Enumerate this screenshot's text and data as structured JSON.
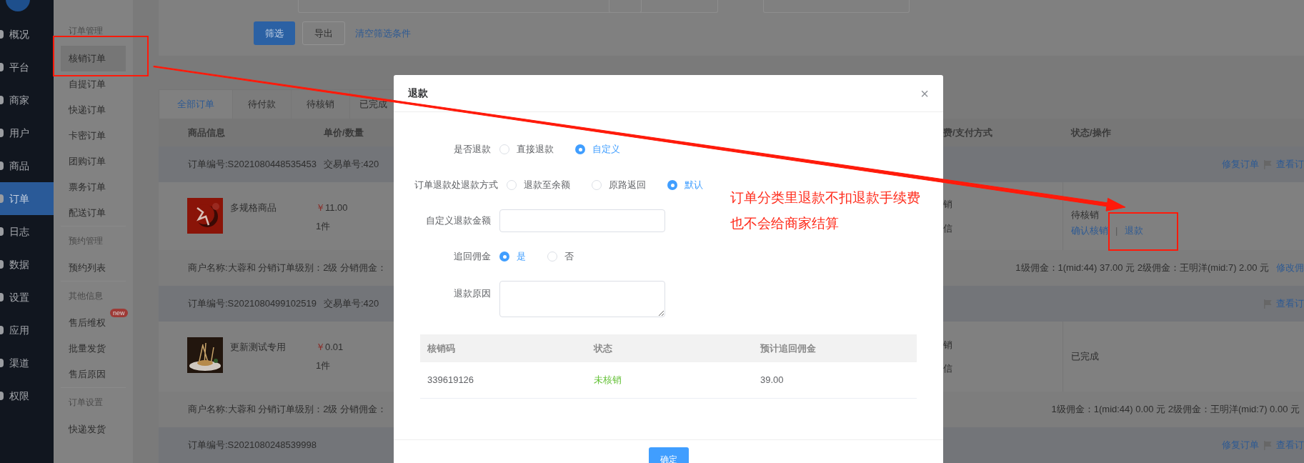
{
  "main_nav": {
    "items": [
      {
        "label": "概况",
        "selected": false
      },
      {
        "label": "平台",
        "selected": false
      },
      {
        "label": "商家",
        "selected": false
      },
      {
        "label": "用户",
        "selected": false
      },
      {
        "label": "商品",
        "selected": false
      },
      {
        "label": "订单",
        "selected": true
      },
      {
        "label": "日志",
        "selected": false
      },
      {
        "label": "数据",
        "selected": false
      },
      {
        "label": "设置",
        "selected": false
      },
      {
        "label": "应用",
        "selected": false
      },
      {
        "label": "渠道",
        "selected": false
      },
      {
        "label": "权限",
        "selected": false
      }
    ]
  },
  "sub_nav": {
    "groups": [
      {
        "heading": "订单管理",
        "items": [
          {
            "label": "核销订单",
            "selected": true
          },
          {
            "label": "自提订单",
            "selected": false
          },
          {
            "label": "快递订单",
            "selected": false
          },
          {
            "label": "卡密订单",
            "selected": false
          },
          {
            "label": "团购订单",
            "selected": false
          },
          {
            "label": "票务订单",
            "selected": false
          },
          {
            "label": "配送订单",
            "selected": false
          }
        ]
      },
      {
        "heading": "预约管理",
        "items": [
          {
            "label": "预约列表",
            "selected": false
          }
        ]
      },
      {
        "heading": "其他信息",
        "items": [
          {
            "label": "售后维权",
            "selected": false,
            "badge": "new"
          },
          {
            "label": "批量发货",
            "selected": false
          },
          {
            "label": "售后原因",
            "selected": false
          }
        ]
      },
      {
        "heading": "订单设置",
        "items": [
          {
            "label": "快递发货",
            "selected": false
          }
        ]
      }
    ]
  },
  "filters": {
    "buttons": [
      {
        "label": "筛选",
        "kind": "primary"
      },
      {
        "label": "导出",
        "kind": "default"
      }
    ],
    "clear_link": "清空筛选条件"
  },
  "tabs": [
    {
      "label": "全部订单",
      "selected": true
    },
    {
      "label": "待付款",
      "selected": false
    },
    {
      "label": "待核销",
      "selected": false
    },
    {
      "label": "已完成",
      "selected": false
    }
  ],
  "table": {
    "columns": [
      "商品信息",
      "单价/数量",
      "费/支付方式",
      "状态/操作"
    ],
    "orders": [
      {
        "order_no": "订单编号:S2021080448535453",
        "trade_no": "交易单号:420",
        "header_actions": [
          {
            "label": "修复订单",
            "kind": "plain"
          },
          {
            "label": "查看订",
            "kind": "flagged"
          }
        ],
        "product": {
          "name": "多规格商品",
          "currency": "￥",
          "price": "11.00",
          "qty": "1件",
          "payment": [
            "销",
            "信"
          ],
          "status": "待核销",
          "actions": [
            "确认核销",
            "退款"
          ],
          "separator": "|"
        },
        "merchant": {
          "info": "商户名称:大蓉和 分销订单级别：2级 分销佣金：",
          "commission": "1级佣金：1(mid:44) 37.00 元   2级佣金：王明洋(mid:7) 2.00 元",
          "link": "修改佣"
        }
      },
      {
        "order_no": "订单编号:S2021080499102519",
        "trade_no": "交易单号:420",
        "header_actions": [
          {
            "label": "查看订",
            "kind": "flagged"
          }
        ],
        "product": {
          "name": "更新测试专用",
          "currency": "￥",
          "price": "0.01",
          "qty": "1件",
          "payment": [
            "销",
            "信"
          ],
          "status": "已完成"
        },
        "merchant": {
          "info": "商户名称:大蓉和 分销订单级别：2级 分销佣金：",
          "commission": "1级佣金：1(mid:44) 0.00 元   2级佣金：王明洋(mid:7) 0.00 元"
        }
      },
      {
        "order_no": "订单编号:S2021080248539998",
        "header_actions": [
          {
            "label": "修复订单",
            "kind": "plain"
          },
          {
            "label": "查看订",
            "kind": "flagged"
          }
        ]
      }
    ]
  },
  "modal": {
    "title": "退款",
    "close": "×",
    "fields": [
      {
        "label": "是否退款",
        "kind": "radio",
        "options": [
          {
            "label": "直接退款",
            "selected": false
          },
          {
            "label": "自定义",
            "selected": true
          }
        ]
      },
      {
        "label": "订单退款处退款方式",
        "kind": "radio",
        "options": [
          {
            "label": "退款至余额",
            "selected": false
          },
          {
            "label": "原路返回",
            "selected": false
          },
          {
            "label": "默认",
            "selected": true
          }
        ]
      },
      {
        "label": "自定义退款金额",
        "kind": "input"
      },
      {
        "label": "追回佣金",
        "kind": "radio",
        "options": [
          {
            "label": "是",
            "selected": true
          },
          {
            "label": "否",
            "selected": false
          }
        ]
      },
      {
        "label": "退款原因",
        "kind": "textarea"
      }
    ],
    "table": {
      "columns": [
        "核销码",
        "状态",
        "预计追回佣金"
      ],
      "rows": [
        {
          "code": "339619126",
          "status": "未核销",
          "amount": "39.00"
        }
      ]
    },
    "confirm": "确定"
  },
  "annotation": {
    "lines": [
      "订单分类里退款不扣退款手续费",
      "也不会给商家结算"
    ]
  }
}
